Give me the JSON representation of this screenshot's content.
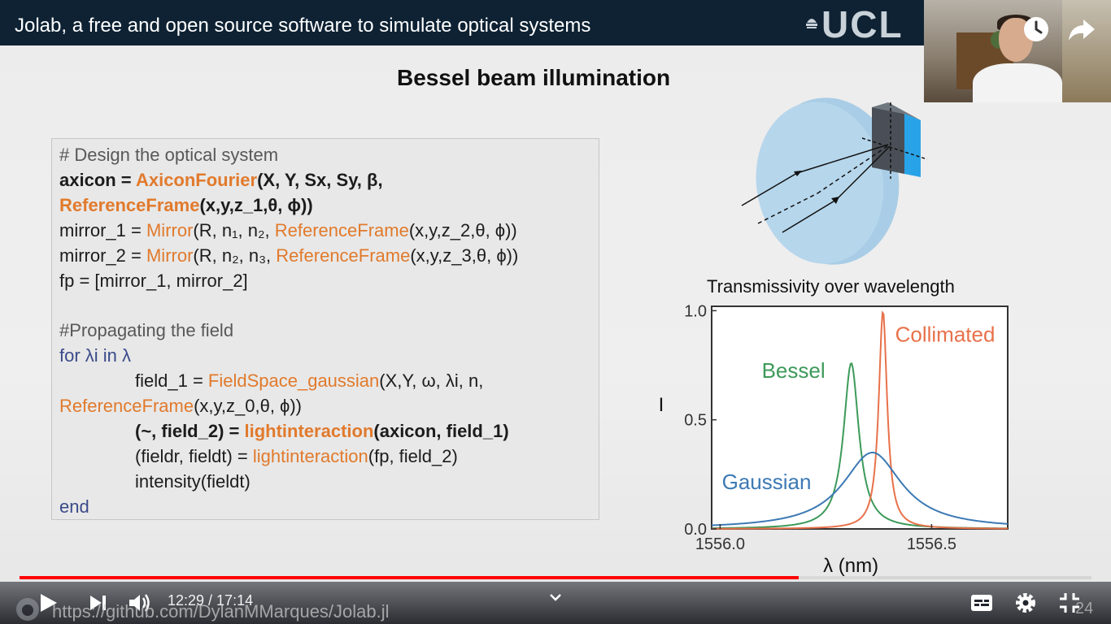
{
  "video": {
    "title": "Jolab, a free and open source software to simulate optical systems",
    "logo_text": "UCL",
    "current_time": "12:29",
    "duration": "17:14",
    "time_display": "12:29 / 17:14",
    "progress_fraction": 0.7266,
    "buffer_fraction": 0.8,
    "source_url": "https://github.com/DylanMMarques/Jolab.jl",
    "slide_number": "24"
  },
  "slide": {
    "heading": "Bessel beam illumination",
    "code": {
      "lines": [
        {
          "parts": [
            {
              "t": "# Design the optical system",
              "c": "comment"
            }
          ]
        },
        {
          "parts": [
            {
              "t": "axicon = ",
              "c": "bold"
            },
            {
              "t": "AxiconFourier",
              "c": "fn-bold"
            },
            {
              "t": "(X, Y, Sx, Sy, β,",
              "c": "bold"
            }
          ]
        },
        {
          "parts": [
            {
              "t": "ReferenceFrame",
              "c": "fn-bold"
            },
            {
              "t": "(x,y,z_1,θ, ϕ))",
              "c": "bold"
            }
          ]
        },
        {
          "parts": [
            {
              "t": "mirror_1 = ",
              "c": ""
            },
            {
              "t": "Mirror",
              "c": "fn"
            },
            {
              "t": "(R, n₁, n₂, ",
              "c": ""
            },
            {
              "t": "ReferenceFrame",
              "c": "fn"
            },
            {
              "t": "(x,y,z_2,θ, ϕ))",
              "c": ""
            }
          ]
        },
        {
          "parts": [
            {
              "t": "mirror_2 = ",
              "c": ""
            },
            {
              "t": "Mirror",
              "c": "fn"
            },
            {
              "t": "(R, n₂, n₃, ",
              "c": ""
            },
            {
              "t": "ReferenceFrame",
              "c": "fn"
            },
            {
              "t": "(x,y,z_3,θ, ϕ))",
              "c": ""
            }
          ]
        },
        {
          "parts": [
            {
              "t": "fp = [mirror_1, mirror_2]",
              "c": ""
            }
          ]
        },
        {
          "parts": [
            {
              "t": "",
              "c": ""
            }
          ]
        },
        {
          "parts": [
            {
              "t": "#Propagating the field",
              "c": "comment"
            }
          ]
        },
        {
          "parts": [
            {
              "t": "for λi in λ",
              "c": "kw"
            }
          ]
        },
        {
          "indent": true,
          "parts": [
            {
              "t": "field_1 = ",
              "c": ""
            },
            {
              "t": "FieldSpace_gaussian",
              "c": "fn"
            },
            {
              "t": "(X,Y, ω, λi, n,",
              "c": ""
            }
          ]
        },
        {
          "parts": [
            {
              "t": "ReferenceFrame",
              "c": "fn"
            },
            {
              "t": "(x,y,z_0,θ, ϕ))",
              "c": ""
            }
          ]
        },
        {
          "indent": true,
          "parts": [
            {
              "t": "(~, field_2) = ",
              "c": "bold"
            },
            {
              "t": "lightinteraction",
              "c": "fn-bold"
            },
            {
              "t": "(axicon, field_1)",
              "c": "bold"
            }
          ]
        },
        {
          "indent": true,
          "parts": [
            {
              "t": "(fieldr, fieldt) = ",
              "c": ""
            },
            {
              "t": "lightinteraction",
              "c": "fn"
            },
            {
              "t": "(fp, field_2)",
              "c": ""
            }
          ]
        },
        {
          "indent": true,
          "parts": [
            {
              "t": "intensity(fieldt)",
              "c": ""
            }
          ]
        },
        {
          "parts": [
            {
              "t": "end",
              "c": "kw"
            }
          ]
        }
      ]
    }
  },
  "chart_data": {
    "type": "line",
    "title": "Transmissivity over wavelength",
    "xlabel": "λ (nm)",
    "ylabel": "I",
    "xlim": [
      1555.98,
      1556.68
    ],
    "ylim": [
      0.0,
      1.02
    ],
    "x_ticks": [
      "1556.0",
      "1556.5"
    ],
    "x_tick_values": [
      1556.0,
      1556.5
    ],
    "y_ticks": [
      "0.0",
      "0.5",
      "1.0"
    ],
    "y_tick_values": [
      0.0,
      0.5,
      1.0
    ],
    "grid": false,
    "series": [
      {
        "name": "Bessel",
        "color": "#3d9a5a",
        "center": 1556.31,
        "peak": 0.76,
        "hwhm": 0.022
      },
      {
        "name": "Collimated",
        "color": "#e8714a",
        "center": 1556.385,
        "peak": 1.0,
        "hwhm": 0.012
      },
      {
        "name": "Gaussian",
        "color": "#3c79b4",
        "center": 1556.36,
        "peak": 0.35,
        "hwhm": 0.085
      }
    ]
  },
  "colors": {
    "title_bar": "#0e2233",
    "progress_played": "#ff0000",
    "code_function": "#e17a2c",
    "code_keyword": "#3a4a8a"
  }
}
